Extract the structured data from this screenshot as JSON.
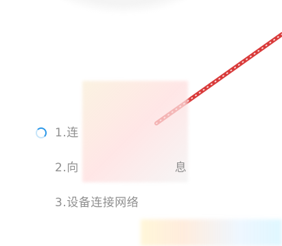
{
  "steps": [
    {
      "label": "1.连"
    },
    {
      "label": "2.向",
      "label_suffix": "息"
    },
    {
      "label": "3.设备连接网络"
    }
  ],
  "icons": {
    "loading": "spinner-icon"
  }
}
